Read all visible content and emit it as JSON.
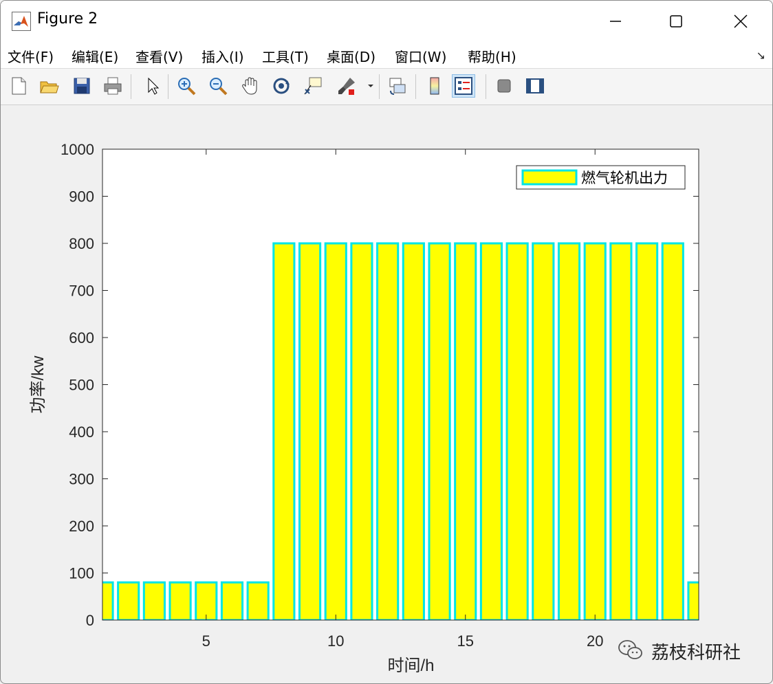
{
  "window": {
    "title": "Figure 2"
  },
  "menu": [
    "文件(F)",
    "编辑(E)",
    "查看(V)",
    "插入(I)",
    "工具(T)",
    "桌面(D)",
    "窗口(W)",
    "帮助(H)"
  ],
  "toolbar": {
    "icons": [
      "new-file-icon",
      "open-folder-icon",
      "save-icon",
      "print-icon",
      "pointer-icon",
      "zoom-in-icon",
      "zoom-out-icon",
      "pan-hand-icon",
      "rotate-3d-icon",
      "data-cursor-icon",
      "brush-icon",
      "link-plot-icon",
      "colorbar-icon",
      "legend-icon",
      "hide-plot-tools-icon",
      "show-plot-tools-icon"
    ]
  },
  "colors": {
    "bar_fill": "#ffff00",
    "bar_edge": "#00e5e5",
    "plot_bg": "#ffffff",
    "figure_bg": "#f0f0f0"
  },
  "watermark": "荔枝科研社",
  "chart_data": {
    "type": "bar",
    "x": [
      1,
      2,
      3,
      4,
      5,
      6,
      7,
      8,
      9,
      10,
      11,
      12,
      13,
      14,
      15,
      16,
      17,
      18,
      19,
      20,
      21,
      22,
      23,
      24
    ],
    "series": [
      {
        "name": "燃气轮机出力",
        "values": [
          80,
          80,
          80,
          80,
          80,
          80,
          80,
          800,
          800,
          800,
          800,
          800,
          800,
          800,
          800,
          800,
          800,
          800,
          800,
          800,
          800,
          800,
          800,
          80
        ]
      }
    ],
    "xlabel": "时间/h",
    "ylabel": "功率/kw",
    "xlim": [
      1,
      24
    ],
    "ylim": [
      0,
      1000
    ],
    "xticks": [
      5,
      10,
      15,
      20
    ],
    "yticks": [
      0,
      100,
      200,
      300,
      400,
      500,
      600,
      700,
      800,
      900,
      1000
    ],
    "legend_position": "top-right",
    "grid": false
  }
}
